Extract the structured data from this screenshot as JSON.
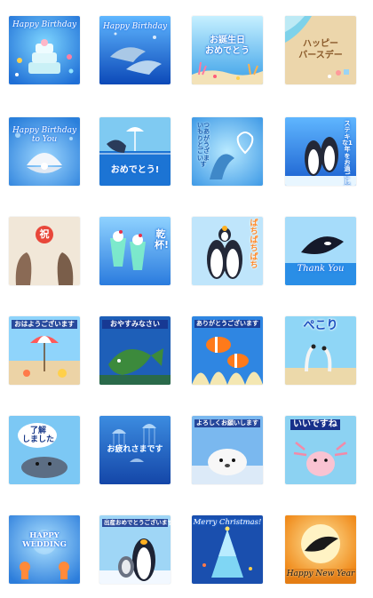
{
  "tiles": [
    {
      "id": "happy-birthday-cake",
      "caption": "Happy Birthday"
    },
    {
      "id": "happy-birthday-dolphins",
      "caption": "Happy Birthday"
    },
    {
      "id": "otanjoubi-omedetou",
      "caption": "お誕生日\nおめでとう"
    },
    {
      "id": "happy-birthday-beach",
      "caption": "ハッピー\nバースデー"
    },
    {
      "id": "happy-birthday-to-you-shell",
      "caption": "Happy Birthday\nto You"
    },
    {
      "id": "omedetou-whale",
      "caption": "おめでとう!"
    },
    {
      "id": "itsumo-arigatou-dolphin",
      "caption": "いつもありがとうございます"
    },
    {
      "id": "penguins-thanks",
      "caption": "ステキな1年をお過ごし下さい"
    },
    {
      "id": "iwai-sea-lions",
      "caption": "祝"
    },
    {
      "id": "kanpai-cream-soda",
      "caption": "乾杯!"
    },
    {
      "id": "pachi-pachi-penguins",
      "caption": "ぱちぱちぱち"
    },
    {
      "id": "thank-you-orca",
      "caption": "Thank You"
    },
    {
      "id": "ohayou-beach",
      "caption": "おはようございます"
    },
    {
      "id": "oyasumi-fish",
      "caption": "おやすみなさい"
    },
    {
      "id": "arigatou-clownfish",
      "caption": "ありがとうございます"
    },
    {
      "id": "pekori-eels",
      "caption": "ぺこり"
    },
    {
      "id": "ryoukai-seal",
      "caption": "了解\nしました"
    },
    {
      "id": "otsukare-jellyfish",
      "caption": "お疲れさまです"
    },
    {
      "id": "yoroshiku-seal-pup",
      "caption": "よろしくお願いします"
    },
    {
      "id": "iine-axolotl",
      "caption": "いいですね"
    },
    {
      "id": "happy-wedding",
      "caption": "HAPPY\nWEDDING"
    },
    {
      "id": "shussan-penguins",
      "caption": "出産おめでとうございます"
    },
    {
      "id": "merry-christmas",
      "caption": "Merry Christmas!"
    },
    {
      "id": "happy-new-year",
      "caption": "Happy New Year"
    }
  ],
  "colors": {
    "ocean": "#1f7fe0",
    "sky": "#7ec8f4",
    "sand": "#e8d3a8",
    "sunset": "#f39a2a"
  }
}
